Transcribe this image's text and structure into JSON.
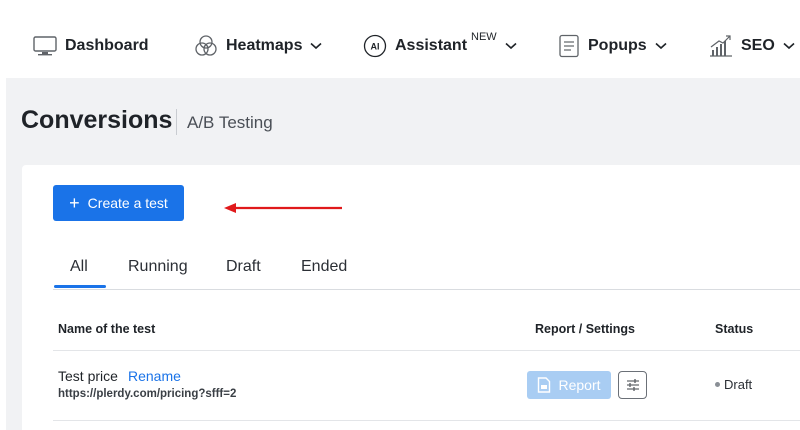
{
  "nav": {
    "items": [
      {
        "label": "Dashboard",
        "icon": "monitor-icon"
      },
      {
        "label": "Heatmaps",
        "icon": "heatmap-circles-icon"
      },
      {
        "label": "Assistant",
        "icon": "ai-badge-icon",
        "badge": "NEW",
        "icon_text": "AI"
      },
      {
        "label": "Popups",
        "icon": "document-icon"
      },
      {
        "label": "SEO",
        "icon": "bar-growth-icon"
      }
    ]
  },
  "page": {
    "title": "Conversions",
    "subtitle": "A/B Testing"
  },
  "actions": {
    "create_label": "Create a test",
    "create_icon": "+"
  },
  "tabs": [
    "All",
    "Running",
    "Draft",
    "Ended"
  ],
  "active_tab": "All",
  "table": {
    "headers": {
      "name": "Name of the test",
      "report": "Report / Settings",
      "status": "Status"
    },
    "rows": [
      {
        "name": "Test price",
        "rename": "Rename",
        "url": "https://plerdy.com/pricing?sfff=2",
        "report_label": "Report",
        "status": "Draft"
      }
    ]
  },
  "colors": {
    "accent": "#1a73e8",
    "disabled_accent": "#a9cdf3",
    "annotation_arrow": "#e0191b",
    "page_bg": "#f1f2f4"
  }
}
